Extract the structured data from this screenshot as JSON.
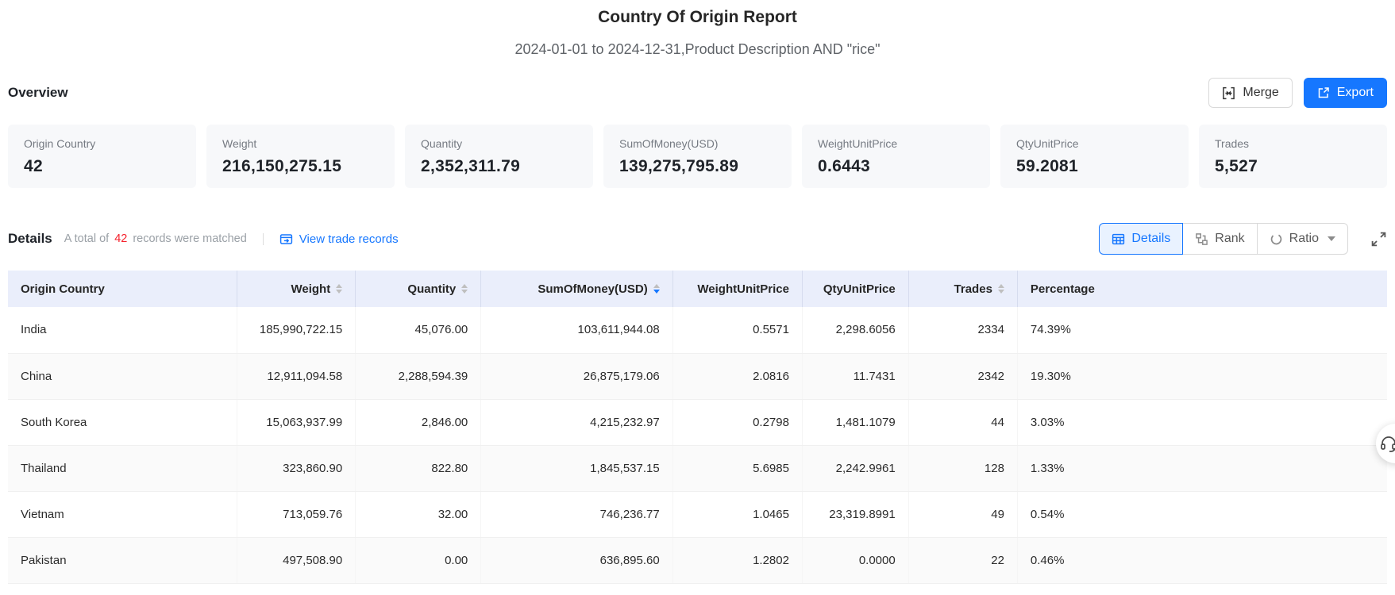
{
  "page": {
    "title": "Country Of Origin Report",
    "subtitle": "2024-01-01 to 2024-12-31,Product Description AND \"rice\""
  },
  "toolbar": {
    "merge": "Merge",
    "export": "Export"
  },
  "overview": {
    "heading": "Overview",
    "cards": [
      {
        "label": "Origin Country",
        "value": "42"
      },
      {
        "label": "Weight",
        "value": "216,150,275.15"
      },
      {
        "label": "Quantity",
        "value": "2,352,311.79"
      },
      {
        "label": "SumOfMoney(USD)",
        "value": "139,275,795.89"
      },
      {
        "label": "WeightUnitPrice",
        "value": "0.6443"
      },
      {
        "label": "QtyUnitPrice",
        "value": "59.2081"
      },
      {
        "label": "Trades",
        "value": "5,527"
      }
    ]
  },
  "details": {
    "heading": "Details",
    "matched_prefix": "A total of",
    "matched_count": "42",
    "matched_suffix": "records were matched",
    "view_trade_records": "View trade records",
    "view_tabs": [
      {
        "label": "Details",
        "icon": "table-grid-icon",
        "active": true,
        "caret": false
      },
      {
        "label": "Rank",
        "icon": "rank-icon",
        "active": false,
        "caret": false
      },
      {
        "label": "Ratio",
        "icon": "ratio-donut-icon",
        "active": false,
        "caret": true
      }
    ],
    "fullscreen_icon": "fullscreen-expand-icon"
  },
  "table": {
    "columns": [
      {
        "label": "Origin Country",
        "align": "left",
        "sortable": false,
        "sort": null
      },
      {
        "label": "Weight",
        "align": "right",
        "sortable": true,
        "sort": null
      },
      {
        "label": "Quantity",
        "align": "right",
        "sortable": true,
        "sort": null
      },
      {
        "label": "SumOfMoney(USD)",
        "align": "right",
        "sortable": true,
        "sort": "desc"
      },
      {
        "label": "WeightUnitPrice",
        "align": "right",
        "sortable": false,
        "sort": null
      },
      {
        "label": "QtyUnitPrice",
        "align": "right",
        "sortable": false,
        "sort": null
      },
      {
        "label": "Trades",
        "align": "right",
        "sortable": true,
        "sort": null
      },
      {
        "label": "Percentage",
        "align": "left",
        "sortable": false,
        "sort": null
      }
    ],
    "rows": [
      [
        "India",
        "185,990,722.15",
        "45,076.00",
        "103,611,944.08",
        "0.5571",
        "2,298.6056",
        "2334",
        "74.39%"
      ],
      [
        "China",
        "12,911,094.58",
        "2,288,594.39",
        "26,875,179.06",
        "2.0816",
        "11.7431",
        "2342",
        "19.30%"
      ],
      [
        "South Korea",
        "15,063,937.99",
        "2,846.00",
        "4,215,232.97",
        "0.2798",
        "1,481.1079",
        "44",
        "3.03%"
      ],
      [
        "Thailand",
        "323,860.90",
        "822.80",
        "1,845,537.15",
        "5.6985",
        "2,242.9961",
        "128",
        "1.33%"
      ],
      [
        "Vietnam",
        "713,059.76",
        "32.00",
        "746,236.77",
        "1.0465",
        "23,319.8991",
        "49",
        "0.54%"
      ],
      [
        "Pakistan",
        "497,508.90",
        "0.00",
        "636,895.60",
        "1.2802",
        "0.0000",
        "22",
        "0.46%"
      ]
    ]
  },
  "floating": {
    "support_icon": "headset-icon"
  },
  "colors": {
    "accent": "#1677ff",
    "count_red": "#f5222d",
    "table_header_bg": "#eaeefb"
  }
}
